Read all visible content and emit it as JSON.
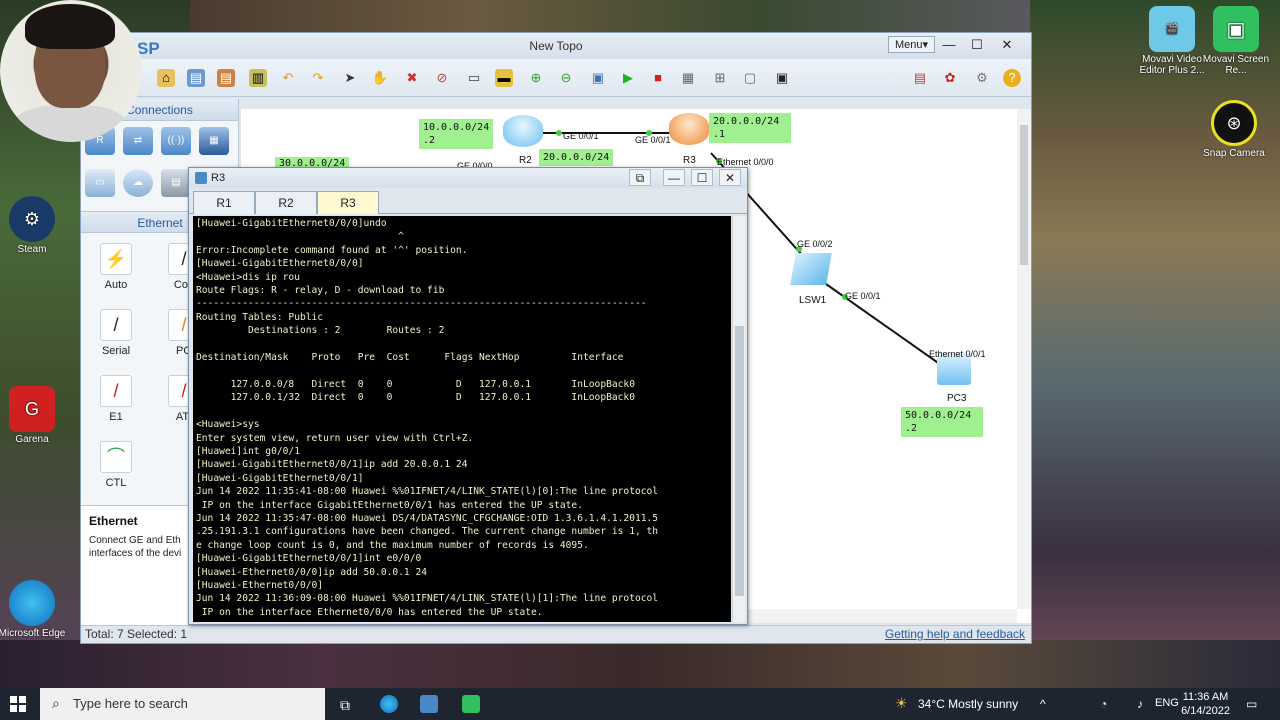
{
  "desktop": {
    "icons": [
      {
        "label": "Movavi Video Editor Plus 2..."
      },
      {
        "label": "Movavi Screen Re..."
      },
      {
        "label": "Snap Camera"
      },
      {
        "label": "Steam"
      },
      {
        "label": "Garena"
      },
      {
        "label": "Microsoft Edge"
      }
    ]
  },
  "app": {
    "logo": "SP",
    "title": "New Topo",
    "menu": "Menu▾",
    "status_left": "Total: 7  Selected: 1",
    "status_right": "Getting help and feedback"
  },
  "left_panel": {
    "header": "Connections",
    "section": "Ethernet",
    "cables": [
      {
        "label": "Auto"
      },
      {
        "label": "Cop"
      },
      {
        "label": "Serial"
      },
      {
        "label": "PO"
      },
      {
        "label": "E1"
      },
      {
        "label": "ATI"
      },
      {
        "label": "CTL"
      }
    ],
    "desc_title": "Ethernet",
    "desc_text": "Connect GE and Eth\ninterfaces of the devi"
  },
  "topology": {
    "labels": {
      "r2_net1": "10.0.0.0/24\n.2",
      "r2_net2": "20.0.0.0/24",
      "r3_net": "20.0.0.0/24\n.1",
      "left_net": "30.0.0.0/24",
      "pc3_net": "50.0.0.0/24\n.2"
    },
    "ports": {
      "r2_ge": "GE 0/0/1",
      "r3_ge": "GE 0/0/1",
      "r2_ge0": "GE 0/0/0",
      "r3_eth": "Ethernet 0/0/0",
      "lsw_ge2": "GE 0/0/2",
      "lsw_ge1": "GE 0/0/1",
      "pc_eth": "Ethernet 0/0/1"
    },
    "devices": {
      "r2": "R2",
      "r3": "R3",
      "lsw1": "LSW1",
      "pc3": "PC3"
    }
  },
  "console": {
    "title": "R3",
    "tabs": [
      "R1",
      "R2",
      "R3"
    ],
    "active_tab": "R3",
    "lines": "[Huawei-GigabitEthernet0/0/0]undo\n                                   ^\nError:Incomplete command found at '^' position.\n[Huawei-GigabitEthernet0/0/0]\n<Huawei>dis ip rou\nRoute Flags: R - relay, D - download to fib\n------------------------------------------------------------------------------\nRouting Tables: Public\n         Destinations : 2        Routes : 2\n\nDestination/Mask    Proto   Pre  Cost      Flags NextHop         Interface\n\n      127.0.0.0/8   Direct  0    0           D   127.0.0.1       InLoopBack0\n      127.0.0.1/32  Direct  0    0           D   127.0.0.1       InLoopBack0\n\n<Huawei>sys\nEnter system view, return user view with Ctrl+Z.\n[Huawei]int g0/0/1\n[Huawei-GigabitEthernet0/0/1]ip add 20.0.0.1 24\n[Huawei-GigabitEthernet0/0/1]\nJun 14 2022 11:35:41-08:00 Huawei %%01IFNET/4/LINK_STATE(l)[0]:The line protocol\n IP on the interface GigabitEthernet0/0/1 has entered the UP state.\nJun 14 2022 11:35:47-08:00 Huawei DS/4/DATASYNC_CFGCHANGE:OID 1.3.6.1.4.1.2011.5\n.25.191.3.1 configurations have been changed. The current change number is 1, th\ne change loop count is 0, and the maximum number of records is 4095.\n[Huawei-GigabitEthernet0/0/1]int e0/0/0\n[Huawei-Ethernet0/0/0]ip add 50.0.0.1 24\n[Huawei-Ethernet0/0/0]\nJun 14 2022 11:36:09-08:00 Huawei %%01IFNET/4/LINK_STATE(l)[1]:The line protocol\n IP on the interface Ethernet0/0/0 has entered the UP state."
  },
  "taskbar": {
    "search_placeholder": "Type here to search",
    "weather": "34°C  Mostly sunny",
    "lang": "ENG",
    "time": "11:36 AM",
    "date": "6/14/2022"
  }
}
